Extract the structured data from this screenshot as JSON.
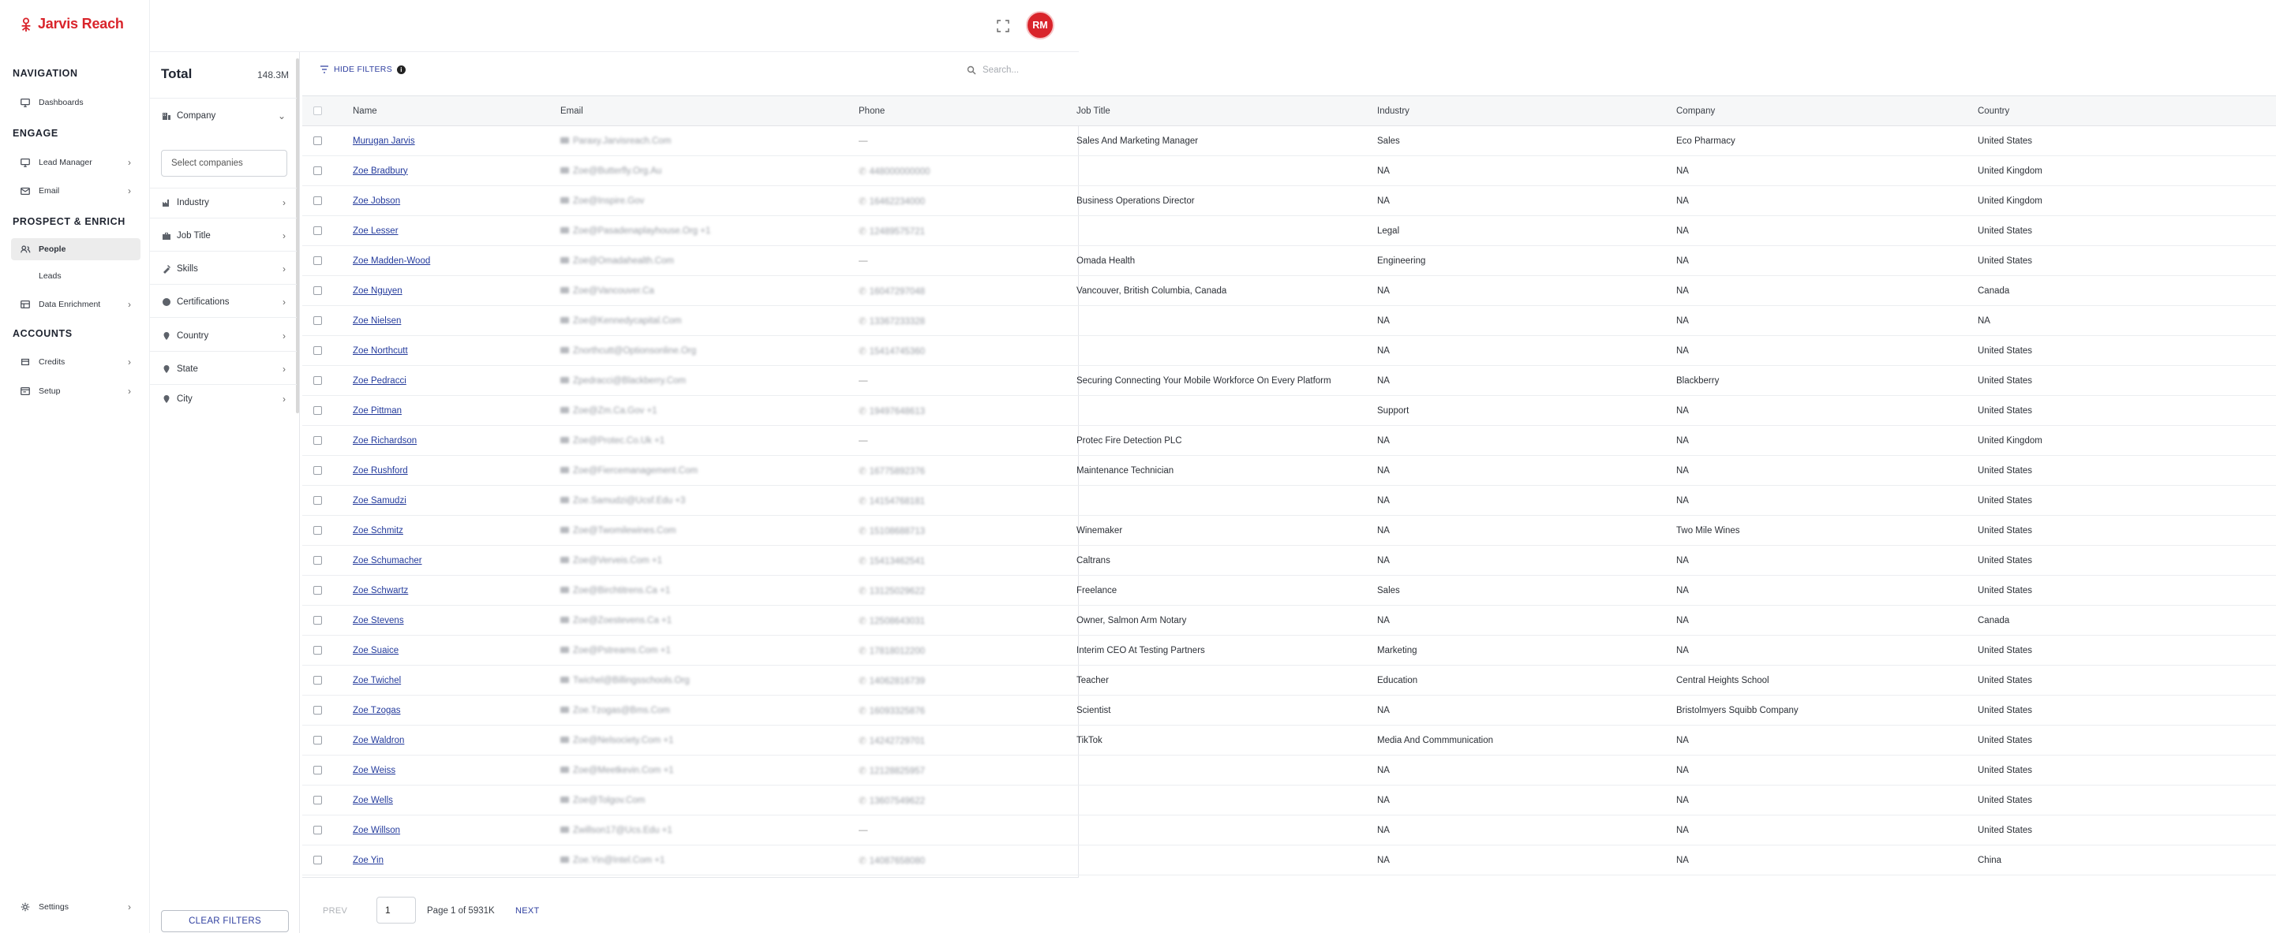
{
  "app": {
    "name": "Jarvis Reach"
  },
  "user": {
    "initials": "RM"
  },
  "nav": {
    "sections": {
      "navigation": "NAVIGATION",
      "engage": "ENGAGE",
      "prospect": "PROSPECT & ENRICH",
      "accounts": "ACCOUNTS"
    },
    "items": {
      "dashboards": "Dashboards",
      "lead_manager": "Lead Manager",
      "email": "Email",
      "people": "People",
      "leads": "Leads",
      "data_enrichment": "Data Enrichment",
      "credits": "Credits",
      "setup": "Setup",
      "settings": "Settings"
    }
  },
  "filters": {
    "total_label": "Total",
    "total_value": "148.3M",
    "company": "Company",
    "company_placeholder": "Select companies",
    "industry": "Industry",
    "job_title": "Job Title",
    "skills": "Skills",
    "certifications": "Certifications",
    "country": "Country",
    "state": "State",
    "city": "City",
    "clear": "CLEAR FILTERS"
  },
  "toolbar": {
    "hide_filters": "HIDE FILTERS",
    "search_placeholder": "Search..."
  },
  "table": {
    "columns": [
      "Name",
      "Email",
      "Phone",
      "Job Title",
      "Industry",
      "Company",
      "Country"
    ],
    "rows": [
      {
        "name": "Murugan Jarvis",
        "email": "Paraxy.Jarvisreach.Com",
        "phone": "—",
        "job": "Sales And Marketing Manager",
        "industry": "Sales",
        "company": "Eco Pharmacy",
        "country": "United States"
      },
      {
        "name": "Zoe Bradbury",
        "email": "Zoe@Butterfly.Org.Au",
        "phone": "448000000000",
        "job": "",
        "industry": "NA",
        "company": "NA",
        "country": "United Kingdom"
      },
      {
        "name": "Zoe Jobson",
        "email": "Zoe@Inspire.Gov",
        "phone": "16462234000",
        "job": "Business Operations Director",
        "industry": "NA",
        "company": "NA",
        "country": "United Kingdom"
      },
      {
        "name": "Zoe Lesser",
        "email": "Zoe@Pasadenaplayhouse.Org +1",
        "phone": "12489575721",
        "job": "",
        "industry": "Legal",
        "company": "NA",
        "country": "United States"
      },
      {
        "name": "Zoe Madden-Wood",
        "email": "Zoe@Omadahealth.Com",
        "phone": "—",
        "job": "Omada Health",
        "industry": "Engineering",
        "company": "NA",
        "country": "United States"
      },
      {
        "name": "Zoe Nguyen",
        "email": "Zoe@Vancouver.Ca",
        "phone": "16047297048",
        "job": "Vancouver, British Columbia, Canada",
        "industry": "NA",
        "company": "NA",
        "country": "Canada"
      },
      {
        "name": "Zoe Nielsen",
        "email": "Zoe@Kennedycapital.Com",
        "phone": "13367233328",
        "job": "",
        "industry": "NA",
        "company": "NA",
        "country": "NA"
      },
      {
        "name": "Zoe Northcutt",
        "email": "Znorthcutt@Optionsonline.Org",
        "phone": "15414745360",
        "job": "",
        "industry": "NA",
        "company": "NA",
        "country": "United States"
      },
      {
        "name": "Zoe Pedracci",
        "email": "Zpedracci@Blackberry.Com",
        "phone": "—",
        "job": "Securing Connecting Your Mobile Workforce On Every Platform",
        "industry": "NA",
        "company": "Blackberry",
        "country": "United States"
      },
      {
        "name": "Zoe Pittman",
        "email": "Zoe@Zm.Ca.Gov +1",
        "phone": "19497648613",
        "job": "",
        "industry": "Support",
        "company": "NA",
        "country": "United States"
      },
      {
        "name": "Zoe Richardson",
        "email": "Zoe@Protec.Co.Uk +1",
        "phone": "—",
        "job": "Protec Fire Detection PLC",
        "industry": "NA",
        "company": "NA",
        "country": "United Kingdom"
      },
      {
        "name": "Zoe Rushford",
        "email": "Zoe@Fiercemanagement.Com",
        "phone": "16775892376",
        "job": "Maintenance Technician",
        "industry": "NA",
        "company": "NA",
        "country": "United States"
      },
      {
        "name": "Zoe Samudzi",
        "email": "Zoe.Samudzi@Ucsf.Edu +3",
        "phone": "14154768181",
        "job": "",
        "industry": "NA",
        "company": "NA",
        "country": "United States"
      },
      {
        "name": "Zoe Schmitz",
        "email": "Zoe@Twomilewines.Com",
        "phone": "15108688713",
        "job": "Winemaker",
        "industry": "NA",
        "company": "Two Mile Wines",
        "country": "United States"
      },
      {
        "name": "Zoe Schumacher",
        "email": "Zoe@Verveis.Com +1",
        "phone": "15413462541",
        "job": "Caltrans",
        "industry": "NA",
        "company": "NA",
        "country": "United States"
      },
      {
        "name": "Zoe Schwartz",
        "email": "Zoe@Birchtitrens.Ca +1",
        "phone": "13125029622",
        "job": "Freelance",
        "industry": "Sales",
        "company": "NA",
        "country": "United States"
      },
      {
        "name": "Zoe Stevens",
        "email": "Zoe@Zoestevens.Ca +1",
        "phone": "12508643031",
        "job": "Owner, Salmon Arm Notary",
        "industry": "NA",
        "company": "NA",
        "country": "Canada"
      },
      {
        "name": "Zoe Suaice",
        "email": "Zoe@Pstreams.Com +1",
        "phone": "17818012200",
        "job": "Interim CEO At Testing Partners",
        "industry": "Marketing",
        "company": "NA",
        "country": "United States"
      },
      {
        "name": "Zoe Twichel",
        "email": "Twichel@Billingsschools.Org",
        "phone": "14062816739",
        "job": "Teacher",
        "industry": "Education",
        "company": "Central Heights School",
        "country": "United States"
      },
      {
        "name": "Zoe Tzogas",
        "email": "Zoe.Tzogas@Bms.Com",
        "phone": "16093325876",
        "job": "Scientist",
        "industry": "NA",
        "company": "Bristolmyers Squibb Company",
        "country": "United States"
      },
      {
        "name": "Zoe Waldron",
        "email": "Zoe@Nelsociety.Com +1",
        "phone": "14242729701",
        "job": "TikTok",
        "industry": "Media And Commmunication",
        "company": "NA",
        "country": "United States"
      },
      {
        "name": "Zoe Weiss",
        "email": "Zoe@Meetkevin.Com +1",
        "phone": "12128825957",
        "job": "",
        "industry": "NA",
        "company": "NA",
        "country": "United States"
      },
      {
        "name": "Zoe Wells",
        "email": "Zoe@Tolgov.Com",
        "phone": "13607549622",
        "job": "",
        "industry": "NA",
        "company": "NA",
        "country": "United States"
      },
      {
        "name": "Zoe Willson",
        "email": "Zwillson17@Ucs.Edu +1",
        "phone": "—",
        "job": "",
        "industry": "NA",
        "company": "NA",
        "country": "United States"
      },
      {
        "name": "Zoe Yin",
        "email": "Zoe.Yin@Intel.Com +1",
        "phone": "14087658080",
        "job": "",
        "industry": "NA",
        "company": "NA",
        "country": "China"
      }
    ]
  },
  "pager": {
    "prev": "PREV",
    "page": "1",
    "info": "Page 1 of 5931K",
    "next": "NEXT"
  }
}
